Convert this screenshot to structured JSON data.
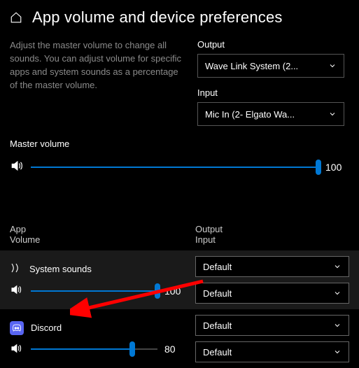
{
  "header": {
    "title": "App volume and device preferences"
  },
  "description": "Adjust the master volume to change all sounds. You can adjust volume for specific apps and system sounds as a percentage of the master volume.",
  "output": {
    "label": "Output",
    "value": "Wave Link System (2..."
  },
  "input": {
    "label": "Input",
    "value": "Mic In (2- Elgato Wa..."
  },
  "master": {
    "label": "Master volume",
    "value": "100",
    "percent": 100
  },
  "columns": {
    "app": "App",
    "volume": "Volume",
    "output": "Output",
    "input": "Input"
  },
  "apps": [
    {
      "name": "System sounds",
      "value": "100",
      "percent": 100,
      "output": "Default",
      "input": "Default"
    },
    {
      "name": "Discord",
      "value": "80",
      "percent": 80,
      "output": "Default",
      "input": "Default"
    }
  ]
}
